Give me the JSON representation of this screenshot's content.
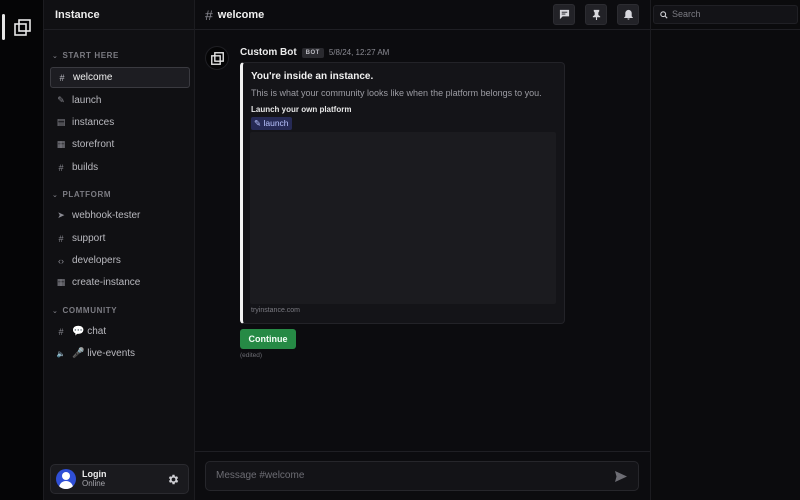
{
  "server": {
    "name": "Instance"
  },
  "sections": [
    {
      "label": "START HERE",
      "channels": [
        {
          "name": "welcome",
          "icon": "#"
        },
        {
          "name": "launch",
          "icon": "✎"
        },
        {
          "name": "instances",
          "icon": "▤"
        },
        {
          "name": "storefront",
          "icon": "▦"
        },
        {
          "name": "builds",
          "icon": "#"
        }
      ]
    },
    {
      "label": "PLATFORM",
      "channels": [
        {
          "name": "webhook-tester",
          "icon": "➤"
        },
        {
          "name": "support",
          "icon": "#"
        },
        {
          "name": "developers",
          "icon": "‹›"
        },
        {
          "name": "create-instance",
          "icon": "▦"
        }
      ]
    },
    {
      "label": "COMMUNITY",
      "channels": [
        {
          "name": "💬 chat",
          "icon": "#"
        },
        {
          "name": "🎤 live-events",
          "icon": "🔈"
        }
      ]
    }
  ],
  "user": {
    "name": "Login",
    "status": "Online"
  },
  "channel": {
    "name": "welcome",
    "hash": "#"
  },
  "message": {
    "author": "Custom Bot",
    "badge": "BOT",
    "timestamp": "5/8/24, 12:27 AM",
    "embed": {
      "title": "You're inside an instance.",
      "description": "This is what your community looks like when the platform belongs to you.",
      "field_name": "Launch your own platform",
      "field_link": "✎ launch",
      "footer": "tryinstance.com"
    },
    "button_label": "Continue",
    "edited": "(edited)"
  },
  "composer": {
    "placeholder": "Message #welcome"
  },
  "search": {
    "placeholder": "Search"
  },
  "colors": {
    "accent_green": "#268a45",
    "link_bg": "#262a55",
    "avatar_blue": "#2f4fd6"
  }
}
